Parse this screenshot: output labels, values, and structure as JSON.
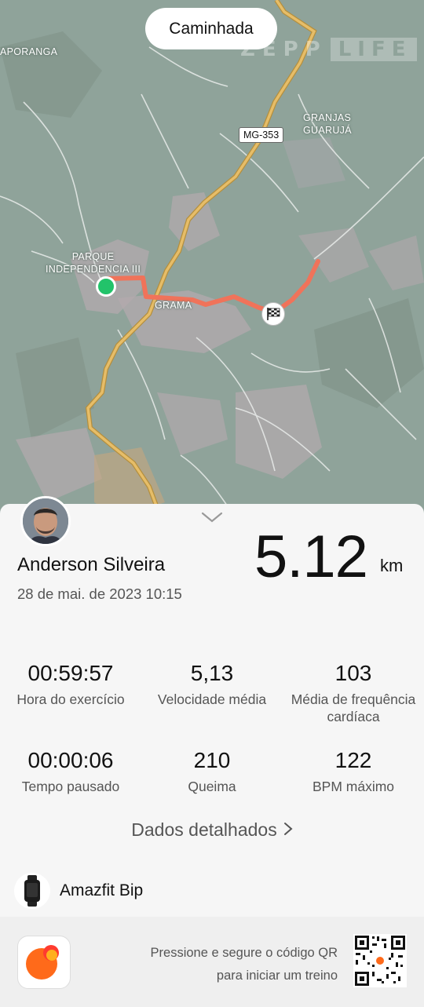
{
  "map": {
    "activity_type": "Caminhada",
    "watermark_left": "ZEPP",
    "watermark_right": "LIFE",
    "labels": {
      "aporanga": "APORANGA",
      "granjas": "GRANJAS\nGUARUJÁ",
      "parque": "PARQUE\nINDEPENDENCIA III",
      "grama": "GRAMA"
    },
    "road_sign": "MG-353",
    "route_color": "#f0735a",
    "start_color": "#22c36a",
    "road_color": "#e3b55a"
  },
  "profile": {
    "name": "Anderson Silveira",
    "date": "28 de mai. de 2023 10:15",
    "distance": "5.12",
    "distance_unit": "km"
  },
  "stats": [
    {
      "value": "00:59:57",
      "label": "Hora do exercício"
    },
    {
      "value": "5,13",
      "label": "Velocidade média"
    },
    {
      "value": "103",
      "label": "Média de frequência\ncardíaca"
    },
    {
      "value": "00:00:06",
      "label": "Tempo pausado"
    },
    {
      "value": "210",
      "label": "Queima"
    },
    {
      "value": "122",
      "label": "BPM máximo"
    }
  ],
  "details_link": "Dados detalhados",
  "device": {
    "name": "Amazfit Bip",
    "icon": "watch-icon"
  },
  "footer": {
    "qr_text_line1": "Pressione e segure o código QR",
    "qr_text_line2": "para iniciar um treino",
    "brand_color": "#ff6a1a"
  }
}
